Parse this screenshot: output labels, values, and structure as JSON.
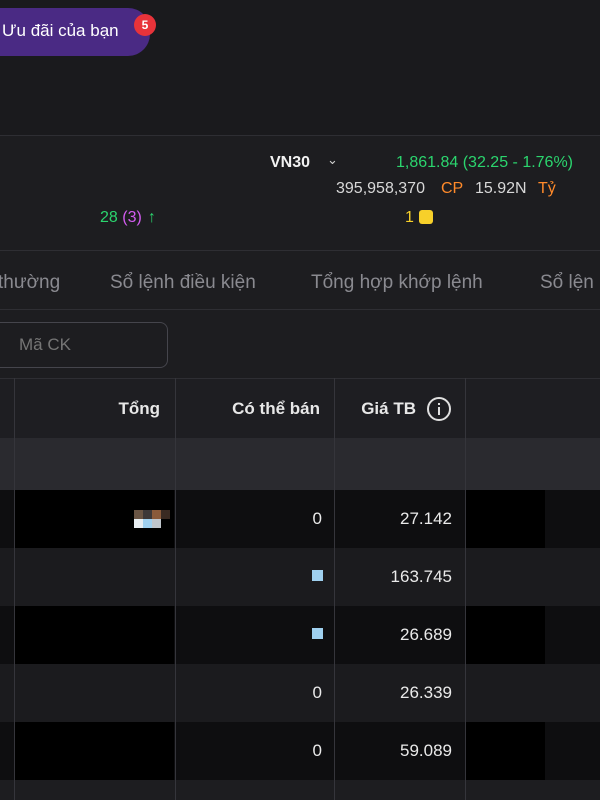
{
  "promo": {
    "label": "Ưu đãi của bạn",
    "badge": "5"
  },
  "market": {
    "index_name": "VN30",
    "index_value": "1,861.84 (32.25 - 1.76%)",
    "volume": "395,958,370",
    "volume_unit": "CP",
    "value": "15.92N",
    "value_unit": "Tỷ",
    "advancers": "28",
    "advancers_ceiling": "(3)",
    "advance_arrow": "↑",
    "reference": "1"
  },
  "tabs": [
    "thường",
    "Sổ lệnh điều kiện",
    "Tổng hợp khớp lệnh",
    "Sổ lện"
  ],
  "search": {
    "placeholder": "Mã CK"
  },
  "table": {
    "headers": {
      "total": "Tổng",
      "available": "Có thể bán",
      "avg_price": "Giá TB"
    },
    "rows": [
      {
        "available": "0",
        "avg_price": "27.142"
      },
      {
        "available": "",
        "avg_price": "163.745"
      },
      {
        "available": "",
        "avg_price": "26.689"
      },
      {
        "available": "0",
        "avg_price": "26.339"
      },
      {
        "available": "0",
        "avg_price": "59.089"
      }
    ]
  },
  "colors": {
    "up": "#2bd56e",
    "ceiling": "#d35cf0",
    "unit": "#ff8a2a",
    "reference": "#f7d02a",
    "promo_bg": "#4a2a84"
  }
}
